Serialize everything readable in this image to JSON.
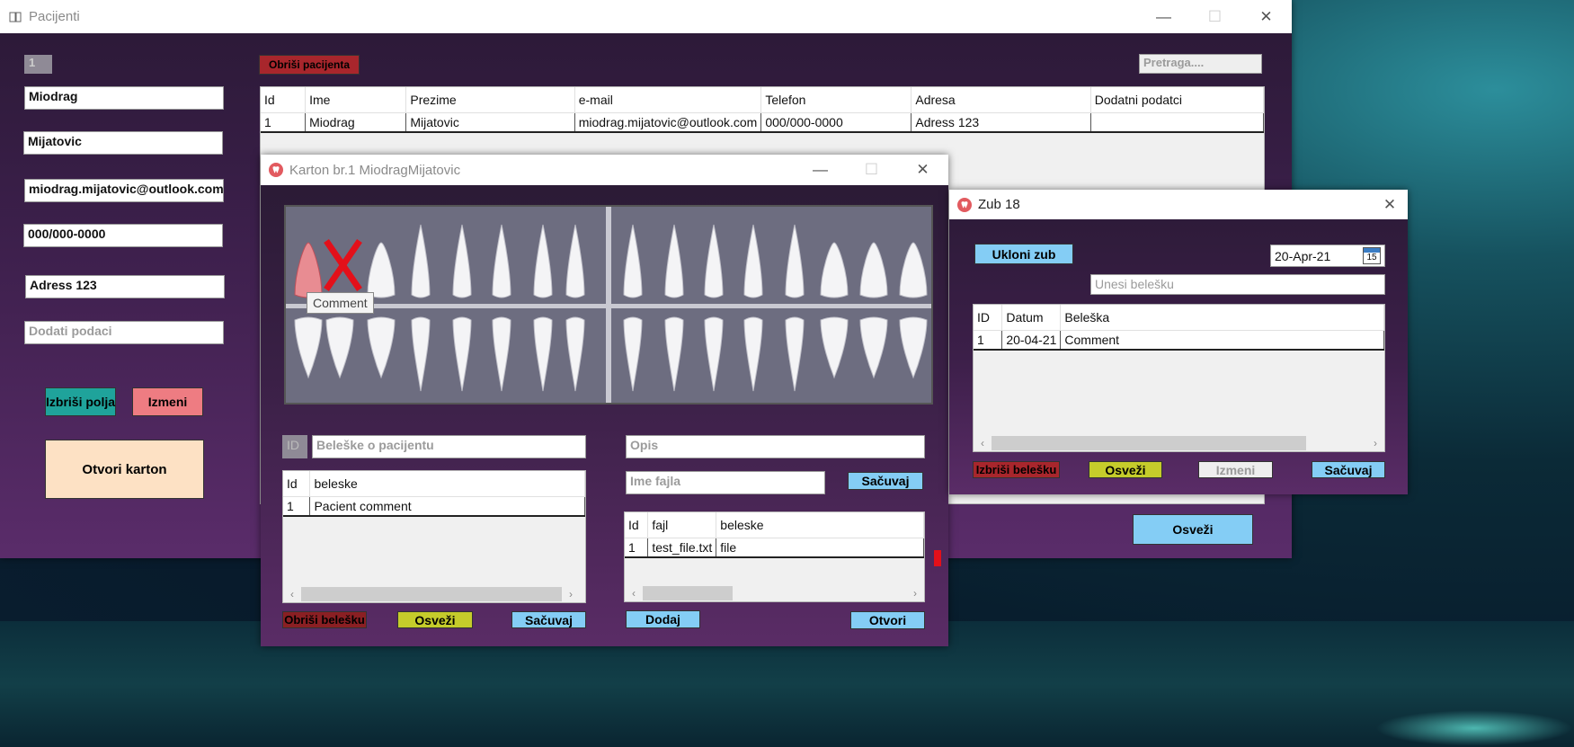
{
  "main": {
    "title": "Pacijenti",
    "id_value": "1",
    "first_name": "Miodrag",
    "last_name": "Mijatovic",
    "email": "miodrag.mijatovic@outlook.com",
    "phone": "000/000-0000",
    "address": "Adress 123",
    "extra_placeholder": "Dodati podaci",
    "clear_button": "Izbriši polja",
    "edit_button": "Izmeni",
    "open_chart_button": "Otvori karton",
    "delete_patient_button": "Obriši pacijenta",
    "search_placeholder": "Pretraga....",
    "refresh_button": "Osveži",
    "table": {
      "headers": [
        "Id",
        "Ime",
        "Prezime",
        "e-mail",
        "Telefon",
        "Adresa",
        "Dodatni podatci"
      ],
      "rows": [
        [
          "1",
          "Miodrag",
          "Mijatovic",
          "miodrag.mijatovic@outlook.com",
          "000/000-0000",
          "Adress 123",
          ""
        ]
      ]
    }
  },
  "karton": {
    "title": "Karton br.1 MiodragMijatovic",
    "tooltip": "Comment",
    "id_label": "ID",
    "notes_placeholder": "Beleške o pacijentu",
    "notes_table": {
      "headers": [
        "Id",
        "beleske"
      ],
      "rows": [
        [
          "1",
          "Pacient comment"
        ]
      ]
    },
    "delete_note_button": "Obriši belešku",
    "refresh_button": "Osveži",
    "save_button": "Sačuvaj",
    "desc_placeholder": "Opis",
    "filename_placeholder": "Ime fajla",
    "save_file_button": "Sačuvaj",
    "files_table": {
      "headers": [
        "Id",
        "fajl",
        "beleske"
      ],
      "rows": [
        [
          "1",
          "test_file.txt",
          "file"
        ]
      ]
    },
    "add_button": "Dodaj",
    "open_button": "Otvori"
  },
  "zub": {
    "title": "Zub 18",
    "remove_tooth_button": "Ukloni zub",
    "date": "20-Apr-21",
    "calendar_day": "15",
    "note_placeholder": "Unesi belešku",
    "table": {
      "headers": [
        "ID",
        "Datum",
        "Beleška"
      ],
      "rows": [
        [
          "1",
          "20-04-21",
          "Comment"
        ]
      ]
    },
    "delete_note_button": "Izbriši belešku",
    "refresh_button": "Osveži",
    "edit_button": "Izmeni",
    "save_button": "Sačuvaj"
  },
  "colors": {
    "accent_red": "#e3101a",
    "tooth_selected": "#e88c92"
  }
}
